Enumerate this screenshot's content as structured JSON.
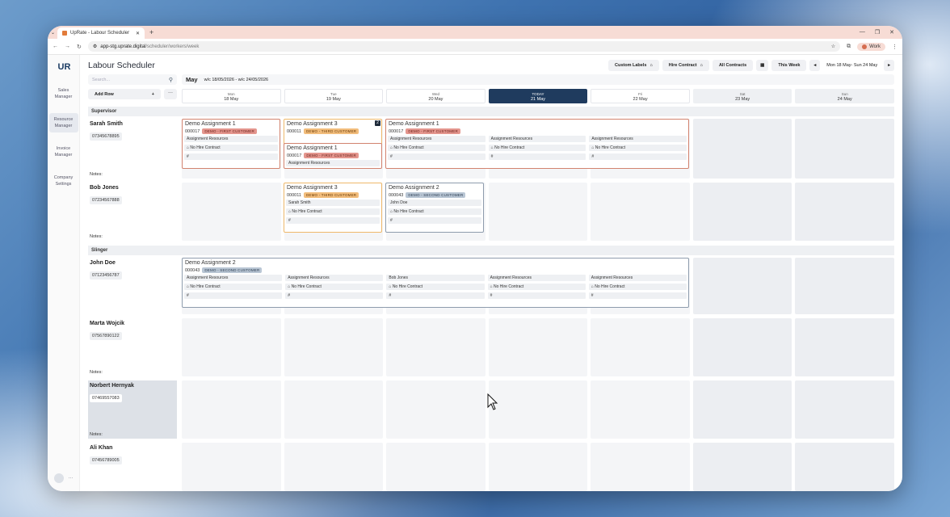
{
  "browser": {
    "tab_title": "UpRate - Labour Scheduler",
    "url_host": "app-stg.uprate.digital",
    "url_path": "/scheduler/workers/week",
    "profile": "Work"
  },
  "sidebar": {
    "logo": "UR",
    "items": [
      {
        "label": "Sales Manager"
      },
      {
        "label": "Resource Manager"
      },
      {
        "label": "Invoice Manager"
      },
      {
        "label": "Company Settings"
      }
    ],
    "more": "···"
  },
  "header": {
    "title": "Labour Scheduler",
    "custom_labels": "Custom Labels",
    "hire_contract": "Hire Contract",
    "all_contracts": "All Contracts",
    "this_week": "This Week",
    "range": "Mon 18 May- Sun 24 May"
  },
  "controls": {
    "search_placeholder": "Search...",
    "add_row": "Add Row",
    "plus": "+",
    "more": "···",
    "month": "May",
    "week_range": "w/c 18/05/2026 - w/c 24/05/2026"
  },
  "days": [
    {
      "name": "Mon",
      "date": "18 May"
    },
    {
      "name": "Tue",
      "date": "19 May"
    },
    {
      "name": "Wed",
      "date": "20 May"
    },
    {
      "name": "TODAY",
      "date": "21 May"
    },
    {
      "name": "Fri",
      "date": "22 May"
    },
    {
      "name": "Sat",
      "date": "23 May"
    },
    {
      "name": "Sun",
      "date": "24 May"
    }
  ],
  "groups": {
    "supervisor": "Supervisor",
    "slinger": "Slinger"
  },
  "notes_label": "Notes:",
  "workers": [
    {
      "name": "Sarah Smith",
      "phone": "07345678895"
    },
    {
      "name": "Bob Jones",
      "phone": "07234567888"
    },
    {
      "name": "John Doe",
      "phone": "07123456787"
    },
    {
      "name": "Marta Wojcik",
      "phone": "07567890122"
    },
    {
      "name": "Norbert Hernyak",
      "phone": "07469557083"
    },
    {
      "name": "Ali Khan",
      "phone": "07456789005"
    }
  ],
  "assignments": {
    "a1_title": "Demo Assignment 1",
    "a2_title": "Demo Assignment 2",
    "a3_title": "Demo Assignment 3",
    "code1": "000017",
    "code2": "000043",
    "code3": "000011",
    "cust1": "DEMO - FIRST CUSTOMER",
    "cust2": "DEMO - SECOND CUSTOMER",
    "cust3": "DEMO - THIRD CUSTOMER",
    "assign_res": "Assignment Resources",
    "no_hire": "No Hire Contract",
    "hash": "#",
    "sarah": "Sarah Smith",
    "john": "John Doe",
    "bob": "Bob Jones",
    "stack_count": "2"
  },
  "colors": {
    "today": "#1f3b5e",
    "first_customer": "#e4968e",
    "third_customer": "#f2bd7c",
    "second_customer": "#b9c6d4"
  }
}
